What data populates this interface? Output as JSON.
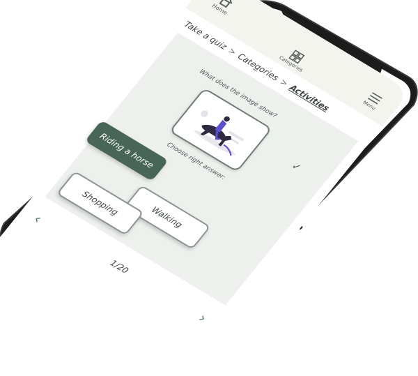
{
  "app": {
    "top_nav": {
      "home_label": "Home",
      "categories_label": "Categories",
      "menu_label": "Menu"
    },
    "breadcrumb": {
      "items": [
        "Take a quiz",
        "Categories",
        "Activities"
      ],
      "separator": ">"
    },
    "quiz": {
      "question": "What does the image show?",
      "prompt": "Choose right answer:",
      "answers": [
        {
          "label": "Riding a horse",
          "selected": true
        },
        {
          "label": "Walking",
          "selected": false
        },
        {
          "label": "Shopping",
          "selected": false
        }
      ],
      "check_icon": "checkmark-icon"
    },
    "pagination": {
      "counter": "1/20",
      "prev_icon": "chevron-left-icon",
      "next_icon": "chevron-right-icon"
    },
    "colors": {
      "accent": "#476657",
      "nav_icon": "#4f7a69",
      "topbar_bg": "#f4f4ee",
      "content_bg": "#eef0ee"
    }
  }
}
